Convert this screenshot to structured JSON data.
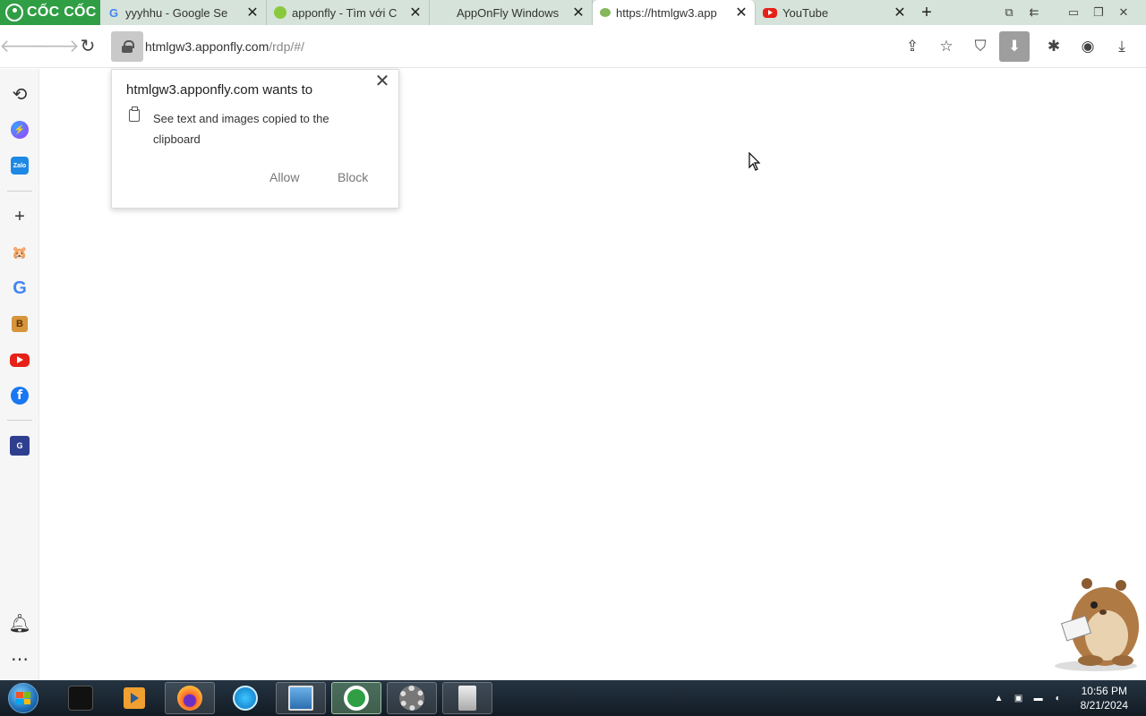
{
  "browser": {
    "brand": "CỐC CỐC",
    "tabs": [
      {
        "title": "yyyhhu - Google Se",
        "favicon": "google-icon"
      },
      {
        "title": "apponfly - Tìm với C",
        "favicon": "coccoc-search-icon"
      },
      {
        "title": "AppOnFly Windows",
        "favicon": "none"
      },
      {
        "title": "https://htmlgw3.app",
        "favicon": "apponfly-icon",
        "active": true
      },
      {
        "title": "YouTube",
        "favicon": "youtube-icon"
      }
    ],
    "new_tab_symbol": "+",
    "close_symbol": "✕"
  },
  "toolbar": {
    "url_host": "htmlgw3.apponfly.com",
    "url_path": "/rdp/#/"
  },
  "popup": {
    "title": "htmlgw3.apponfly.com wants to",
    "description": "See text and images copied to the clipboard",
    "allow_label": "Allow",
    "block_label": "Block"
  },
  "sidebar": {
    "items": [
      {
        "name": "history-icon"
      },
      {
        "name": "messenger-icon"
      },
      {
        "name": "zalo-icon",
        "text": "Zalo"
      },
      {
        "name": "add-icon"
      },
      {
        "name": "mascot-icon"
      },
      {
        "name": "google-icon",
        "text": "G"
      },
      {
        "name": "bookmark-b-icon",
        "text": "B"
      },
      {
        "name": "youtube-icon"
      },
      {
        "name": "facebook-icon",
        "text": "f"
      },
      {
        "name": "app-icon"
      },
      {
        "name": "bell-icon"
      },
      {
        "name": "more-icon"
      }
    ]
  },
  "taskbar": {
    "time": "10:56 PM",
    "date": "8/21/2024"
  },
  "colors": {
    "brand_green": "#2f9e44",
    "tabstrip_bg": "#d6e3da",
    "taskbar_bg": "#1b2631"
  }
}
